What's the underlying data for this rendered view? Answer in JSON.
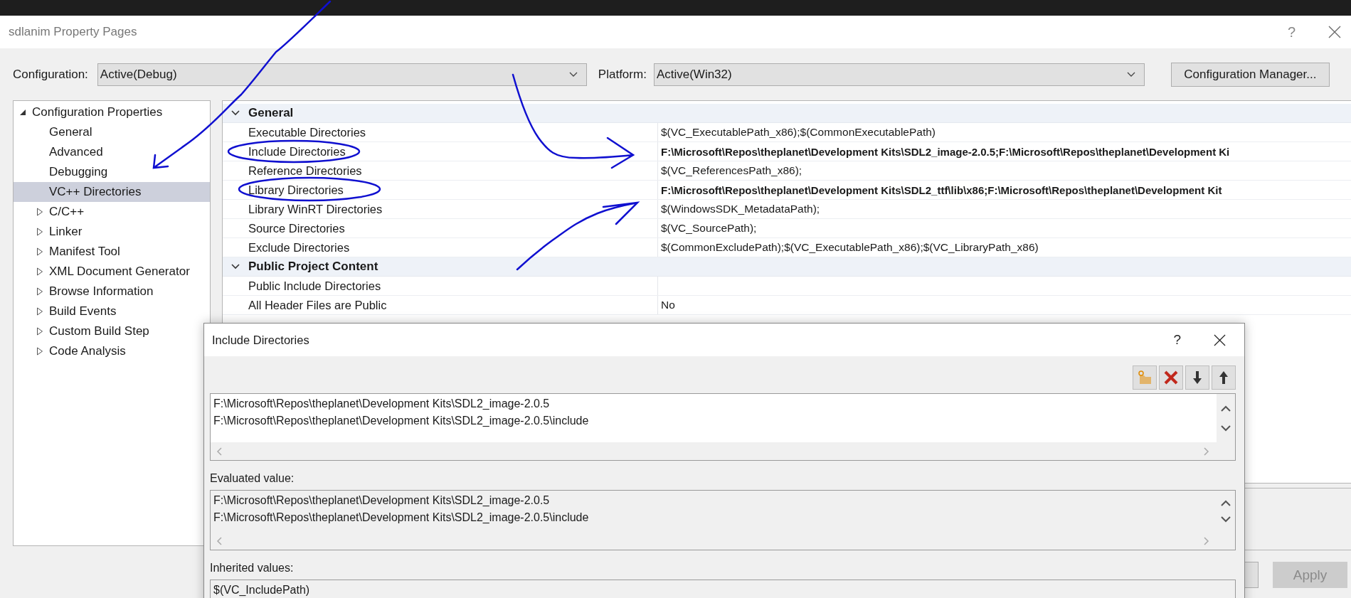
{
  "window": {
    "title": "sdlanim Property Pages",
    "help": "?"
  },
  "configuration": {
    "label": "Configuration:",
    "value": "Active(Debug)"
  },
  "platform": {
    "label": "Platform:",
    "value": "Active(Win32)"
  },
  "configuration_manager_button": "Configuration Manager...",
  "sidebar": {
    "items": [
      {
        "label": "Configuration Properties",
        "expanded": true,
        "selected": false,
        "children": [
          {
            "label": "General",
            "selected": false
          },
          {
            "label": "Advanced",
            "selected": false
          },
          {
            "label": "Debugging",
            "selected": false
          },
          {
            "label": "VC++ Directories",
            "selected": true
          },
          {
            "label": "C/C++",
            "expanded": false,
            "selected": false
          },
          {
            "label": "Linker",
            "expanded": false,
            "selected": false
          },
          {
            "label": "Manifest Tool",
            "expanded": false,
            "selected": false
          },
          {
            "label": "XML Document Generator",
            "expanded": false,
            "selected": false
          },
          {
            "label": "Browse Information",
            "expanded": false,
            "selected": false
          },
          {
            "label": "Build Events",
            "expanded": false,
            "selected": false
          },
          {
            "label": "Custom Build Step",
            "expanded": false,
            "selected": false
          },
          {
            "label": "Code Analysis",
            "expanded": false,
            "selected": false
          }
        ]
      }
    ]
  },
  "grid": {
    "sections": [
      {
        "title": "General",
        "expanded": true,
        "rows": [
          {
            "name": "Executable Directories",
            "value": "$(VC_ExecutablePath_x86);$(CommonExecutablePath)",
            "bold": false
          },
          {
            "name": "Include Directories",
            "value": "F:\\Microsoft\\Repos\\theplanet\\Development Kits\\SDL2_image-2.0.5;F:\\Microsoft\\Repos\\theplanet\\Development Ki",
            "bold": true
          },
          {
            "name": "Reference Directories",
            "value": "$(VC_ReferencesPath_x86);",
            "bold": false
          },
          {
            "name": "Library Directories",
            "value": "F:\\Microsoft\\Repos\\theplanet\\Development Kits\\SDL2_ttf\\lib\\x86;F:\\Microsoft\\Repos\\theplanet\\Development Kit",
            "bold": true
          },
          {
            "name": "Library WinRT Directories",
            "value": "$(WindowsSDK_MetadataPath);",
            "bold": false
          },
          {
            "name": "Source Directories",
            "value": "$(VC_SourcePath);",
            "bold": false
          },
          {
            "name": "Exclude Directories",
            "value": "$(CommonExcludePath);$(VC_ExecutablePath_x86);$(VC_LibraryPath_x86)",
            "bold": false
          }
        ]
      },
      {
        "title": "Public Project Content",
        "expanded": true,
        "rows": [
          {
            "name": "Public Include Directories"
          },
          {
            "name": "All Header Files are Public",
            "value": "No",
            "bold": false
          }
        ]
      }
    ]
  },
  "buttons": [
    {
      "label": "Apply",
      "disabled": true
    }
  ],
  "include_dialog": {
    "title": "Include Directories",
    "help": "?",
    "toolbar": [
      {
        "kind": "new-folder"
      },
      {
        "kind": "delete"
      },
      {
        "kind": "move-down"
      },
      {
        "kind": "move-up"
      }
    ],
    "entries": [
      "F:\\Microsoft\\Repos\\theplanet\\Development Kits\\SDL2_image-2.0.5",
      "F:\\Microsoft\\Repos\\theplanet\\Development Kits\\SDL2_image-2.0.5\\include"
    ],
    "evaluated_label": "Evaluated value:",
    "evaluated": [
      "F:\\Microsoft\\Repos\\theplanet\\Development Kits\\SDL2_image-2.0.5",
      "F:\\Microsoft\\Repos\\theplanet\\Development Kits\\SDL2_image-2.0.5\\include"
    ],
    "inherited_label": "Inherited values:",
    "inherited": [
      "$(VC_IncludePath)"
    ]
  }
}
